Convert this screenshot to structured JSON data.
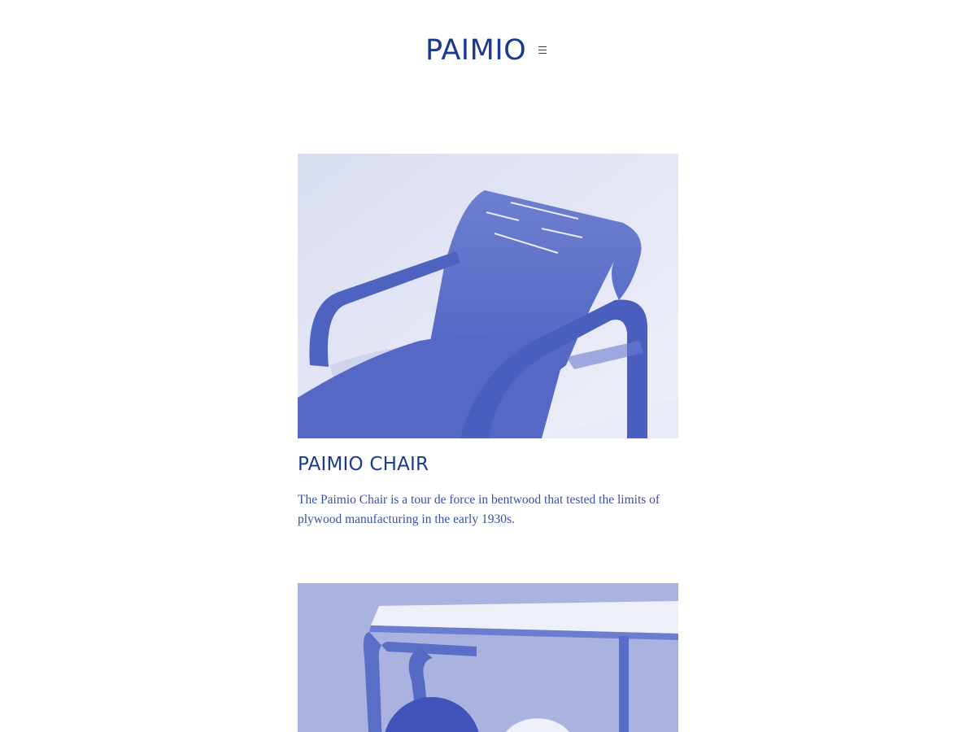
{
  "header": {
    "logo": "PAIMIO",
    "menu_icon": "hamburger-menu-icon"
  },
  "products": [
    {
      "title": "PAIMIO CHAIR",
      "description": "The Paimio Chair is a tour de force in bentwood that tested the limits of plywood manufacturing in the early 1930s."
    },
    {
      "title": "",
      "description": ""
    }
  ],
  "colors": {
    "brand": "#1a3a8f",
    "image_tint": "#5a6ec7",
    "image_background": "#dfe3f3"
  }
}
